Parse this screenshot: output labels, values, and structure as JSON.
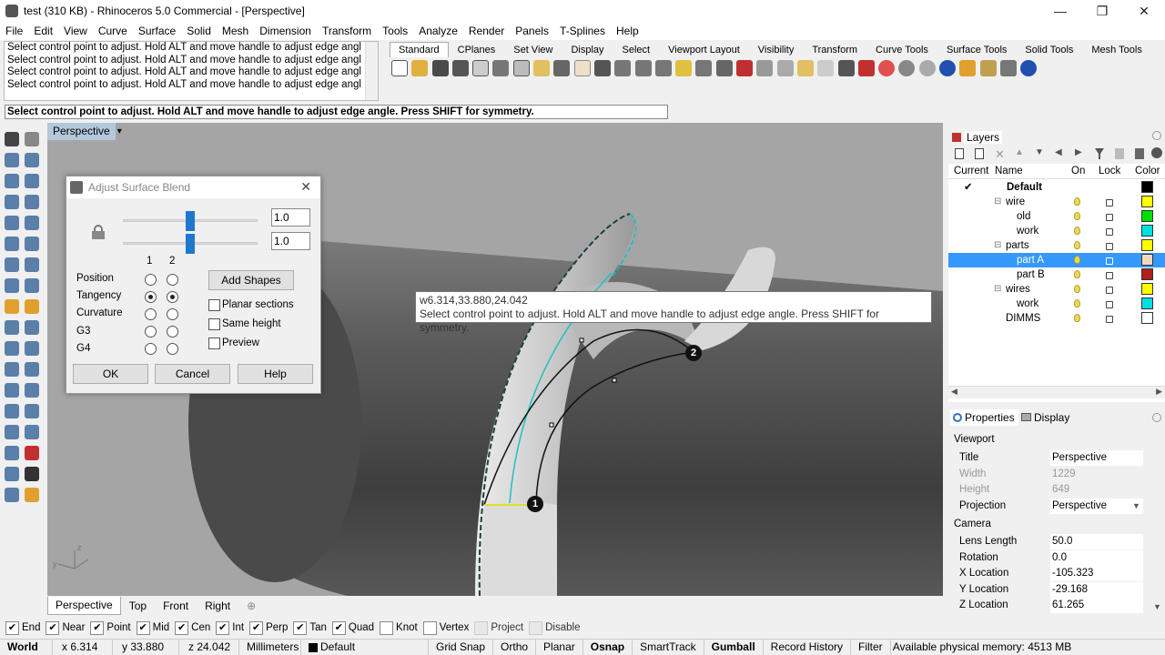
{
  "window": {
    "title": "test (310 KB) - Rhinoceros 5.0 Commercial - [Perspective]",
    "minimize": "—",
    "maximize": "❐",
    "close": "✕"
  },
  "menu": [
    "File",
    "Edit",
    "View",
    "Curve",
    "Surface",
    "Solid",
    "Mesh",
    "Dimension",
    "Transform",
    "Tools",
    "Analyze",
    "Render",
    "Panels",
    "T-Splines",
    "Help"
  ],
  "command_history": [
    "Select control point to adjust. Hold ALT and move handle to adjust edge angl",
    "Select control point to adjust. Hold ALT and move handle to adjust edge angl",
    "Select control point to adjust. Hold ALT and move handle to adjust edge angl",
    "Select control point to adjust. Hold ALT and move handle to adjust edge angl"
  ],
  "command_prompt": "Select control point to adjust. Hold ALT and move handle to adjust edge angle. Press SHIFT for symmetry.",
  "toolbar_tabs": [
    "Standard",
    "CPlanes",
    "Set View",
    "Display",
    "Select",
    "Viewport Layout",
    "Visibility",
    "Transform",
    "Curve Tools",
    "Surface Tools",
    "Solid Tools",
    "Mesh Tools"
  ],
  "toolbar_tabs_active": "Standard",
  "viewport": {
    "name": "Perspective",
    "dropdown": "▾",
    "tooltip_coords": "w6.314,33.880,24.042",
    "tooltip_text": "Select control point to adjust. Hold ALT and move handle to adjust edge angle. Press SHIFT for symmetry.",
    "marker1": "1",
    "marker2": "2",
    "axis_z": "z",
    "axis_y": "y"
  },
  "view_tabs": [
    "Perspective",
    "Top",
    "Front",
    "Right"
  ],
  "view_tabs_add": "⊕",
  "dialog": {
    "title": "Adjust Surface Blend",
    "close": "✕",
    "value1": "1.0",
    "value2": "1.0",
    "col1": "1",
    "col2": "2",
    "rows": [
      "Position",
      "Tangency",
      "Curvature",
      "G3",
      "G4"
    ],
    "add_shapes": "Add Shapes",
    "checks": [
      "Planar sections",
      "Same height",
      "Preview"
    ],
    "ok": "OK",
    "cancel": "Cancel",
    "help": "Help"
  },
  "layers": {
    "tab": "Layers",
    "headers": [
      "Current",
      "Name",
      "On",
      "Lock",
      "Color"
    ],
    "current_mark": "✔",
    "rows": [
      {
        "name": "Default",
        "color": "#000000"
      },
      {
        "name": "wire",
        "color": "#ffff00"
      },
      {
        "name": "old",
        "color": "#00e000"
      },
      {
        "name": "work",
        "color": "#00e0e0"
      },
      {
        "name": "parts",
        "color": "#ffff00"
      },
      {
        "name": "part A",
        "color": "#f0d8c0"
      },
      {
        "name": "part B",
        "color": "#b02020"
      },
      {
        "name": "wires",
        "color": "#ffff00"
      },
      {
        "name": "work",
        "color": "#00e0e0"
      },
      {
        "name": "DIMMS",
        "color": "#ffffff"
      }
    ],
    "expand": "⊟"
  },
  "properties": {
    "tab1": "Properties",
    "tab2": "Display",
    "section1": "Viewport",
    "section2": "Camera",
    "title_k": "Title",
    "title_v": "Perspective",
    "width_k": "Width",
    "width_v": "1229",
    "height_k": "Height",
    "height_v": "649",
    "proj_k": "Projection",
    "proj_v": "Perspective",
    "lens_k": "Lens Length",
    "lens_v": "50.0",
    "rot_k": "Rotation",
    "rot_v": "0.0",
    "xloc_k": "X Location",
    "xloc_v": "-105.323",
    "yloc_k": "Y Location",
    "yloc_v": "-29.168",
    "zloc_k": "Z Location",
    "zloc_v": "61.265"
  },
  "osnaps": [
    {
      "label": "End",
      "checked": true
    },
    {
      "label": "Near",
      "checked": true
    },
    {
      "label": "Point",
      "checked": true
    },
    {
      "label": "Mid",
      "checked": true
    },
    {
      "label": "Cen",
      "checked": true
    },
    {
      "label": "Int",
      "checked": true
    },
    {
      "label": "Perp",
      "checked": true
    },
    {
      "label": "Tan",
      "checked": true
    },
    {
      "label": "Quad",
      "checked": true
    },
    {
      "label": "Knot",
      "checked": false
    },
    {
      "label": "Vertex",
      "checked": false
    },
    {
      "label": "Project",
      "checked": false
    },
    {
      "label": "Disable",
      "checked": false
    }
  ],
  "status": {
    "cplane": "World",
    "x": "x 6.314",
    "y": "y 33.880",
    "z": "z 24.042",
    "units": "Millimeters",
    "layer": "Default",
    "gridsnap": "Grid Snap",
    "ortho": "Ortho",
    "planar": "Planar",
    "osnap": "Osnap",
    "smarttrack": "SmartTrack",
    "gumball": "Gumball",
    "history": "Record History",
    "filter": "Filter",
    "memory": "Available physical memory: 4513 MB"
  }
}
